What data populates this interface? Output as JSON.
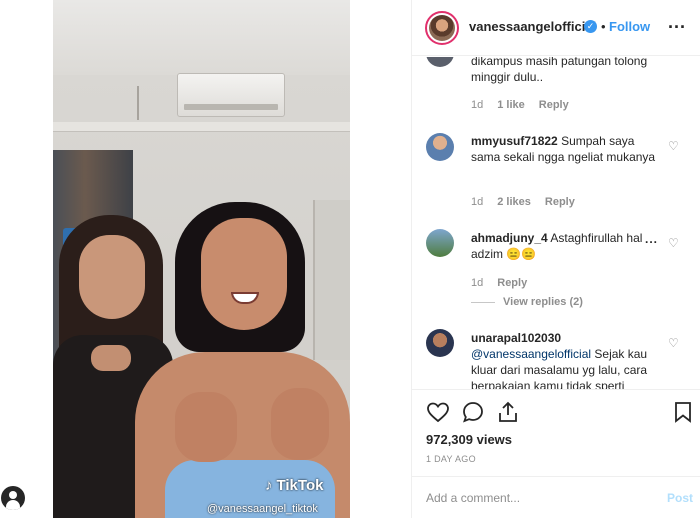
{
  "header": {
    "username": "vanessaangelofficial",
    "separator": "•",
    "follow_label": "Follow",
    "more_label": "..."
  },
  "video": {
    "watermark": "TikTok",
    "watermark_user": "@vanessaangel_tiktok"
  },
  "comments": [
    {
      "text": "dikampus masih patungan tolong minggir dulu..",
      "time": "1d",
      "likes": "1 like",
      "reply": "Reply"
    },
    {
      "username": "mmyusuf71822",
      "text": "Sumpah saya sama sekali ngga ngeliat mukanya",
      "time": "1d",
      "likes": "2 likes",
      "reply": "Reply"
    },
    {
      "username": "ahmadjuny_4",
      "text": "Astaghfirullah hal adzim 😑😑",
      "time": "1d",
      "reply": "Reply",
      "more": "...",
      "view_replies": "View replies (2)"
    },
    {
      "username": "unarapal102030",
      "mention": "@vanessaangelofficial",
      "text": "Sejak kau kluar dari masalamu yg lalu, cara berpakaian kamu tidak sperti"
    }
  ],
  "stats": {
    "views": "972,309 views",
    "time_ago": "1 DAY AGO"
  },
  "add_comment": {
    "placeholder": "Add a comment...",
    "post_label": "Post"
  },
  "colors": {
    "accent": "#3897f0",
    "muted": "#8e8e8e",
    "text": "#262626"
  }
}
